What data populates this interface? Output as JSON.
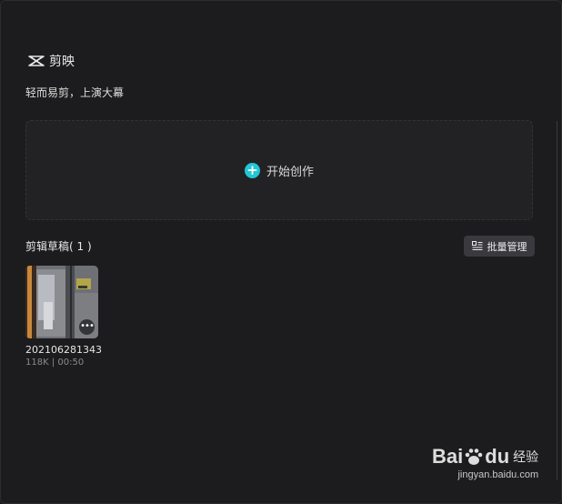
{
  "app": {
    "name": "剪映",
    "tagline": "轻而易剪，上演大幕"
  },
  "create": {
    "label": "开始创作"
  },
  "drafts": {
    "title": "剪辑草稿( 1 )",
    "batch_label": "批量管理",
    "items": [
      {
        "name": "202106281343",
        "meta": "118K | 00:50"
      }
    ]
  },
  "watermark": {
    "brand_left": "Bai",
    "brand_right": "du",
    "suffix": "经验",
    "url": "jingyan.baidu.com"
  },
  "colors": {
    "background": "#1c1c1e",
    "accent": "#22c6d4",
    "panel": "#222224",
    "button": "#3a3a3e"
  }
}
